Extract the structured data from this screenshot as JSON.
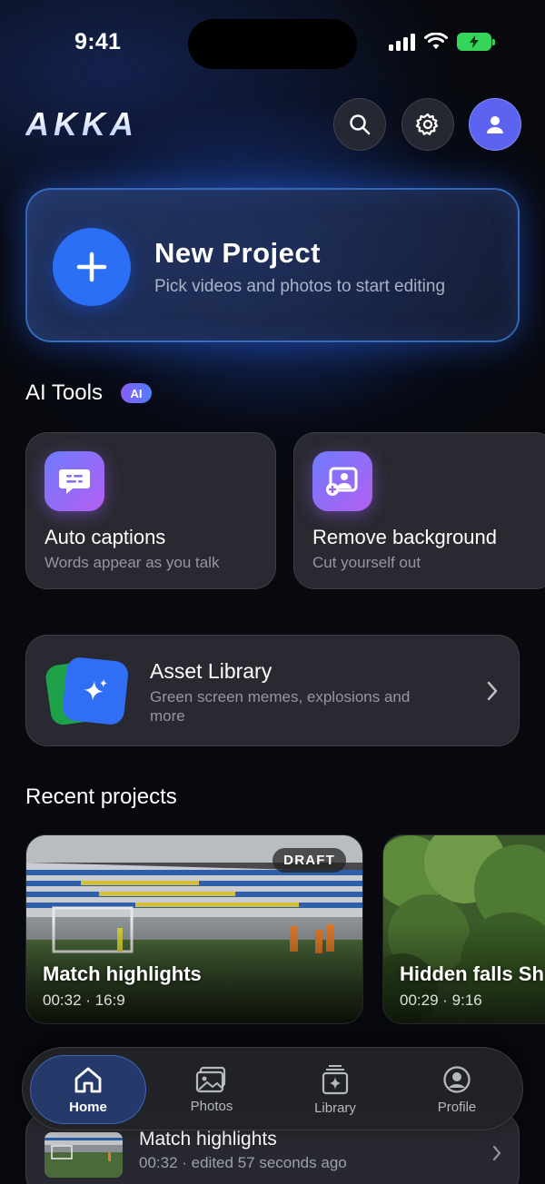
{
  "status_bar": {
    "time": "9:41"
  },
  "header": {
    "logo": "AKKA",
    "icons": [
      "search-icon",
      "gear-icon",
      "profile-avatar-icon"
    ],
    "avatar_color": "#5b63f0"
  },
  "new_project": {
    "title": "New Project",
    "subtitle": "Pick videos and photos to start editing",
    "accent": "#2b6ff5"
  },
  "ai_tools": {
    "title": "AI Tools",
    "badge": "AI",
    "items": [
      {
        "title": "Auto captions",
        "subtitle": "Words appear as you talk",
        "icon": "chat-bubble-icon"
      },
      {
        "title": "Remove background",
        "subtitle": "Cut yourself out",
        "icon": "person-frame-icon"
      }
    ]
  },
  "asset_library": {
    "title": "Asset Library",
    "subtitle": "Green screen memes, explosions and more",
    "icon": "sparkle-icon"
  },
  "recent_projects": {
    "title": "Recent projects",
    "items": [
      {
        "title": "Match highlights",
        "meta": "00:32 · 16:9",
        "badge": "DRAFT"
      },
      {
        "title": "Hidden falls Sh",
        "meta": "00:29 · 9:16"
      }
    ]
  },
  "recent_list": {
    "items": [
      {
        "title": "Match highlights",
        "meta": "00:32 · edited 57 seconds ago"
      }
    ]
  },
  "tabbar": {
    "tabs": [
      {
        "label": "Home",
        "icon": "home-icon",
        "active": true
      },
      {
        "label": "Photos",
        "icon": "photos-icon"
      },
      {
        "label": "Library",
        "icon": "library-icon"
      },
      {
        "label": "Profile",
        "icon": "profile-icon"
      }
    ]
  }
}
